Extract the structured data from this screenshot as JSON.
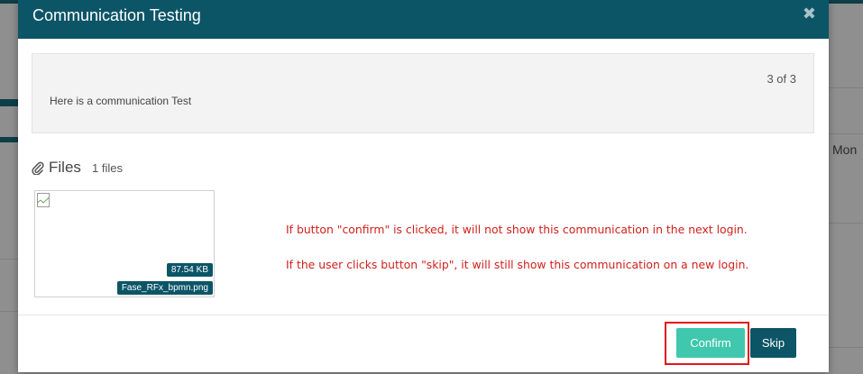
{
  "background": {
    "column_label": "Mon"
  },
  "modal": {
    "title": "Communication Testing",
    "close_icon": "close-icon",
    "header_color": "#0c5567",
    "message": {
      "counter": "3 of 3",
      "text": "Here is a communication Test"
    },
    "files": {
      "icon": "paperclip-icon",
      "title": "Files",
      "count_label": "1 files",
      "items": [
        {
          "size": "87.54 KB",
          "name": "Fase_RFx_bpmn.png",
          "thumbnail_icon": "broken-image-icon"
        }
      ]
    },
    "annotations": [
      "If button \"confirm\" is clicked, it will not show this communication in the next login.",
      "If the user clicks button \"skip\", it will still show this communication on a new login."
    ],
    "annotation_color": "#d0211c",
    "footer": {
      "confirm_label": "Confirm",
      "skip_label": "Skip",
      "confirm_color": "#3fc8ad",
      "skip_color": "#0c5567",
      "highlight_color": "#e0161b"
    }
  }
}
